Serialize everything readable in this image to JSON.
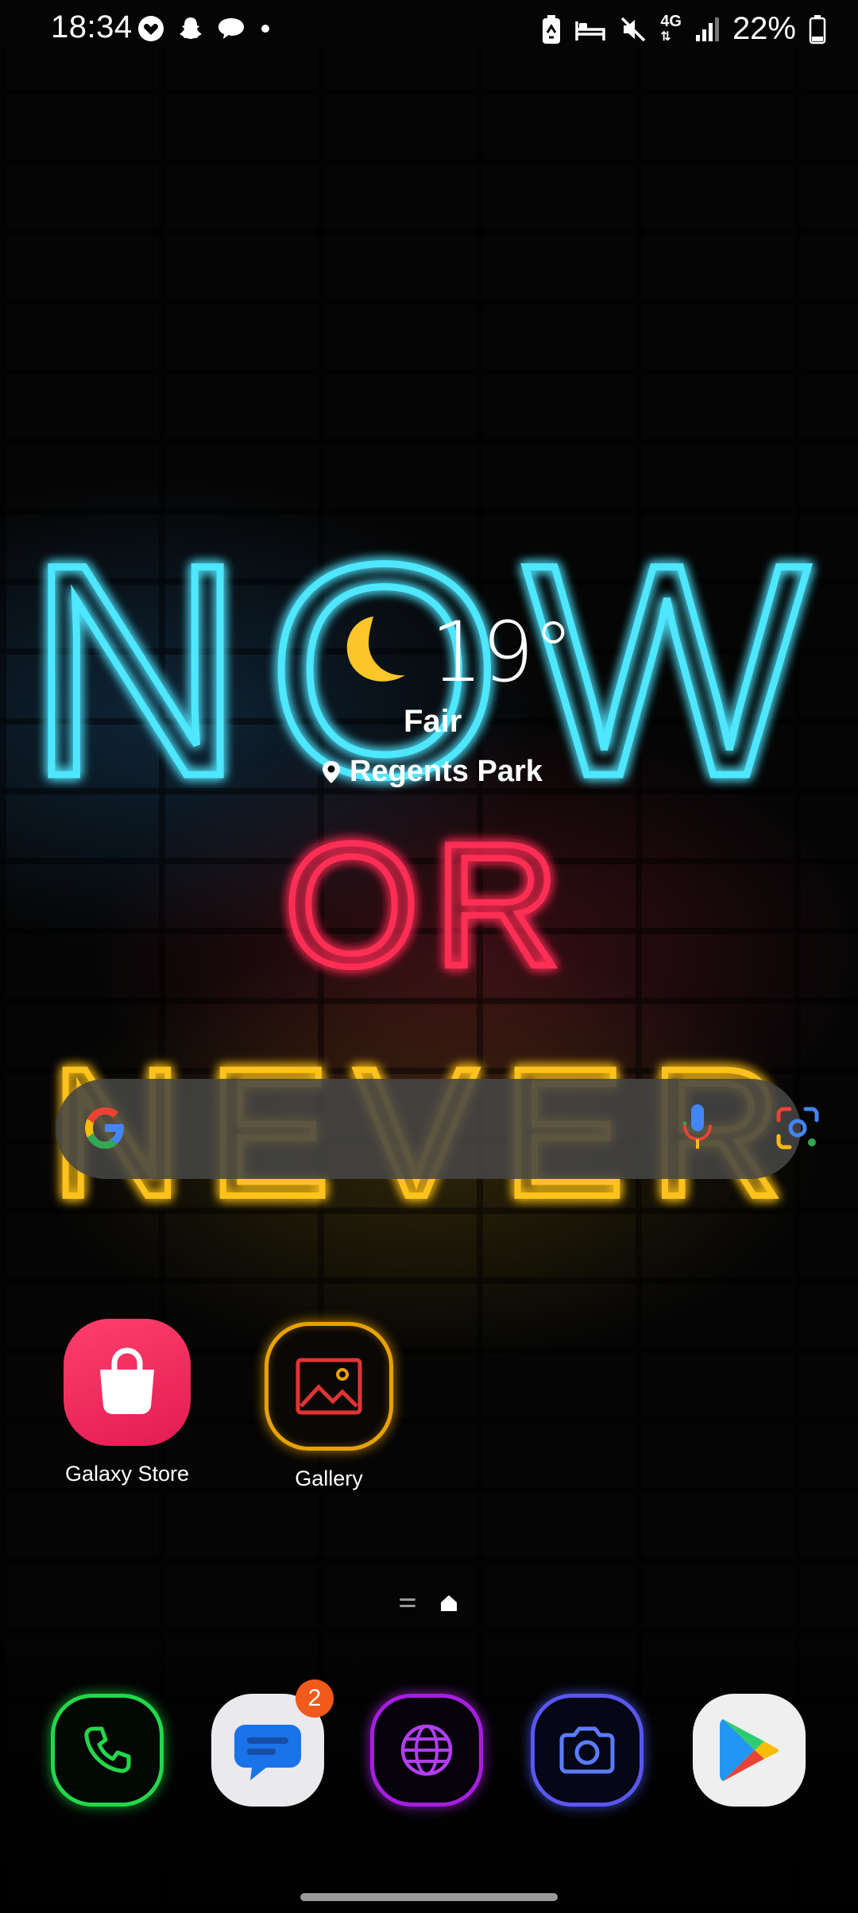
{
  "status_bar": {
    "time": "18:34",
    "left_icons": [
      "heart-notification-icon",
      "snapchat-icon",
      "chat-bubble-icon",
      "dot-icon"
    ],
    "right_icons": [
      "battery-saver-icon",
      "sleep-mode-icon",
      "mute-icon",
      "4g-data-icon",
      "signal-icon",
      "battery-icon"
    ],
    "network_label": "4G",
    "battery_percent": "22%"
  },
  "wallpaper": {
    "line1": "NOW",
    "line2": "OR",
    "line3": "NEVER"
  },
  "weather": {
    "temperature": "19°",
    "condition": "Fair",
    "location": "Regents Park",
    "icon": "moon-icon"
  },
  "search_bar": {
    "logo": "google-g-logo",
    "mic_icon": "mic-icon",
    "lens_icon": "camera-lens-icon"
  },
  "home_apps": [
    {
      "label": "Galaxy Store",
      "icon": "shopping-bag-icon"
    },
    {
      "label": "Gallery",
      "icon": "picture-icon"
    }
  ],
  "page_indicator": {
    "icons": [
      "apps-list-icon",
      "home-icon"
    ]
  },
  "dock": [
    {
      "name": "Phone",
      "icon": "phone-icon"
    },
    {
      "name": "Messages",
      "icon": "message-icon",
      "badge": "2"
    },
    {
      "name": "Internet",
      "icon": "globe-icon"
    },
    {
      "name": "Camera",
      "icon": "camera-icon"
    },
    {
      "name": "Play Store",
      "icon": "play-store-icon"
    }
  ],
  "colors": {
    "neon_blue": "#4fe6ff",
    "neon_red": "#ff2d55",
    "neon_yellow": "#ffc21a",
    "moon_yellow": "#ffc62a",
    "badge_orange": "#f05a1a"
  }
}
